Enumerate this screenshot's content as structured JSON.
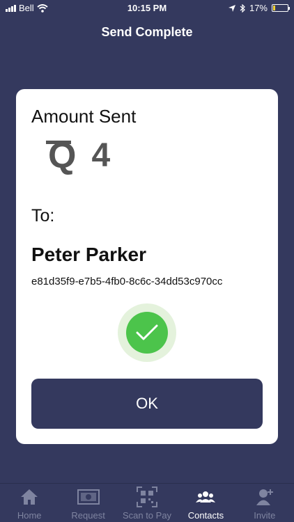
{
  "status_bar": {
    "carrier": "Bell",
    "time": "10:15 PM",
    "battery": "17%",
    "battery_level": 0.17
  },
  "header": {
    "title": "Send Complete"
  },
  "card": {
    "amount_heading": "Amount Sent",
    "currency_symbol": "Q",
    "amount": "4",
    "to_label": "To:",
    "recipient_name": "Peter Parker",
    "recipient_id": "e81d35f9-e7b5-4fb0-8c6c-34dd53c970cc",
    "ok_label": "OK"
  },
  "colors": {
    "background": "#34395e",
    "success": "#4cc44b",
    "tab_inactive": "#7f84a0"
  },
  "tabs": [
    {
      "label": "Home",
      "icon": "home-icon",
      "active": false
    },
    {
      "label": "Request",
      "icon": "banknote-icon",
      "active": false
    },
    {
      "label": "Scan to Pay",
      "icon": "qr-code-icon",
      "active": false
    },
    {
      "label": "Contacts",
      "icon": "contacts-icon",
      "active": true
    },
    {
      "label": "Invite",
      "icon": "add-user-icon",
      "active": false
    }
  ]
}
